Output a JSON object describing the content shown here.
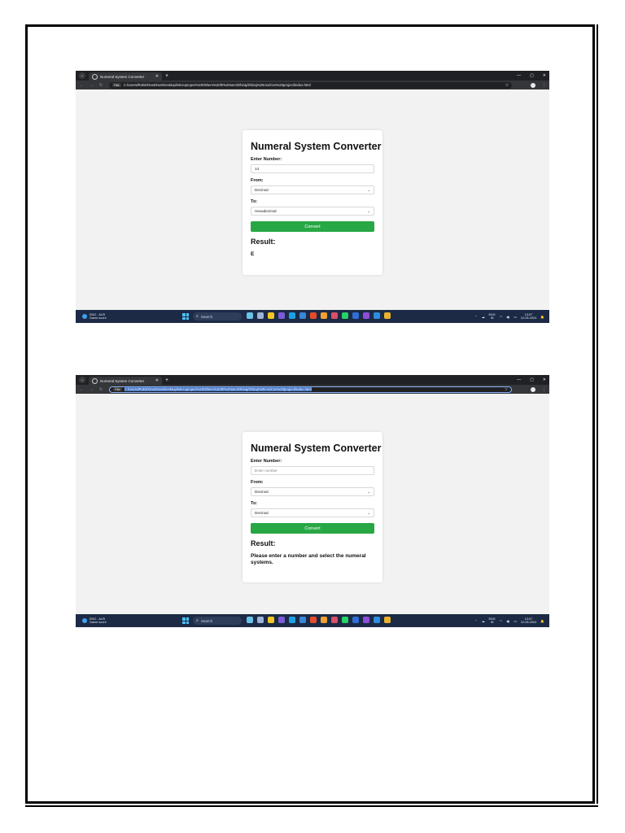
{
  "shots": [
    {
      "tab_title": "Numeral System Converter",
      "file_chip": "File",
      "url": "C:/Users/Rohit/OneDrive/Desktop/Microproject%20Others%20th%20sem/Dhiraj/Dhiraj%20css/Css%20project/index.html",
      "converter": {
        "heading": "Numeral System Converter",
        "number_label": "Enter Number:",
        "number_value": "14",
        "from_label": "From:",
        "from_value": "Decimal",
        "to_label": "To:",
        "to_value": "Hexadecimal",
        "convert_button": "Convert",
        "result_heading": "Result:",
        "result_text": "E"
      },
      "taskbar": {
        "weather_line1": "ENG - AUS",
        "weather_line2": "Game score",
        "search_label": "Search",
        "lang_line1": "ENG",
        "lang_line2": "IN",
        "time": "13:07",
        "date": "12-09-2024"
      }
    },
    {
      "tab_title": "Numeral System Converter",
      "file_chip": "File",
      "url": "C:/Users/Rohit/OneDrive/Desktop/Microproject%20Others%20th%20sem/Dhiraj/Dhiraj%20css/Css%20project/index.html",
      "converter": {
        "heading": "Numeral System Converter",
        "number_label": "Enter Number:",
        "number_placeholder": "Enter number",
        "from_label": "From:",
        "from_value": "Decimal",
        "to_label": "To:",
        "to_value": "Decimal",
        "convert_button": "Convert",
        "result_heading": "Result:",
        "result_text": "Please enter a number and select the numeral systems."
      },
      "taskbar": {
        "weather_line1": "ENG - AUS",
        "weather_line2": "Game score",
        "search_label": "Search",
        "lang_line1": "ENG",
        "lang_line2": "IN",
        "time": "13:07",
        "date": "12-09-2024"
      }
    }
  ],
  "colors": {
    "convert_button": "#28a745",
    "taskbar": "#1c2a45",
    "browser_chrome": "#202124"
  }
}
